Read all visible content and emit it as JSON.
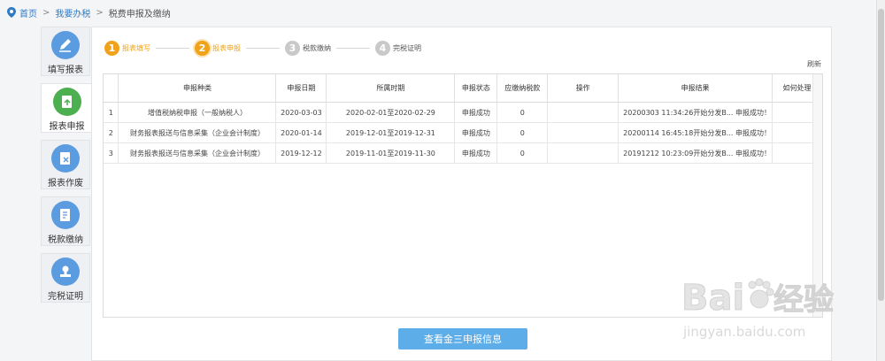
{
  "breadcrumb": {
    "home": "首页",
    "sep1": ">",
    "section": "我要办税",
    "sep2": ">",
    "current": "税费申报及缴纳"
  },
  "sidebar": {
    "items": [
      {
        "label": "填写报表",
        "icon": "edit-icon",
        "color": "#5b9be0"
      },
      {
        "label": "报表申报",
        "icon": "report-submit-icon",
        "color": "#4caf50"
      },
      {
        "label": "报表作废",
        "icon": "report-void-icon",
        "color": "#5b9be0"
      },
      {
        "label": "税款缴纳",
        "icon": "tax-payment-icon",
        "color": "#5b9be0"
      },
      {
        "label": "完税证明",
        "icon": "certificate-stamp-icon",
        "color": "#5b9be0"
      }
    ],
    "active_index": 1
  },
  "steps": [
    {
      "num": "1",
      "label": "报表填写",
      "state": "done"
    },
    {
      "num": "2",
      "label": "报表申报",
      "state": "current"
    },
    {
      "num": "3",
      "label": "税款缴纳",
      "state": "todo"
    },
    {
      "num": "4",
      "label": "完税证明",
      "state": "todo"
    }
  ],
  "refresh_label": "刷新",
  "table": {
    "columns": [
      "",
      "申报种类",
      "申报日期",
      "所属时期",
      "申报状态",
      "应缴纳税款",
      "操作",
      "申报结果",
      "如何处理"
    ],
    "rows": [
      [
        "1",
        "增值税纳税申报（一般纳税人）",
        "2020-03-03",
        "2020-02-01至2020-02-29",
        "申报成功",
        "0",
        "",
        "20200303 11:34:26开始分发B... 申报成功！",
        ""
      ],
      [
        "2",
        "财务报表报送与信息采集（企业会计制度）",
        "2020-01-14",
        "2019-12-01至2019-12-31",
        "申报成功",
        "0",
        "",
        "20200114 16:45:18开始分发B... 申报成功！",
        ""
      ],
      [
        "3",
        "财务报表报送与信息采集（企业会计制度）",
        "2019-12-12",
        "2019-11-01至2019-11-30",
        "申报成功",
        "0",
        "",
        "20191212 10:23:09开始分发B... 申报成功！",
        ""
      ]
    ]
  },
  "query_button": "查看金三申报信息",
  "watermark": {
    "brand": "Bai",
    "brand2": "经验",
    "url": "jingyan.baidu.com"
  },
  "colors": {
    "accent_orange": "#f0a31a",
    "button_blue": "#5dade8",
    "link_blue": "#2f7bc4"
  }
}
